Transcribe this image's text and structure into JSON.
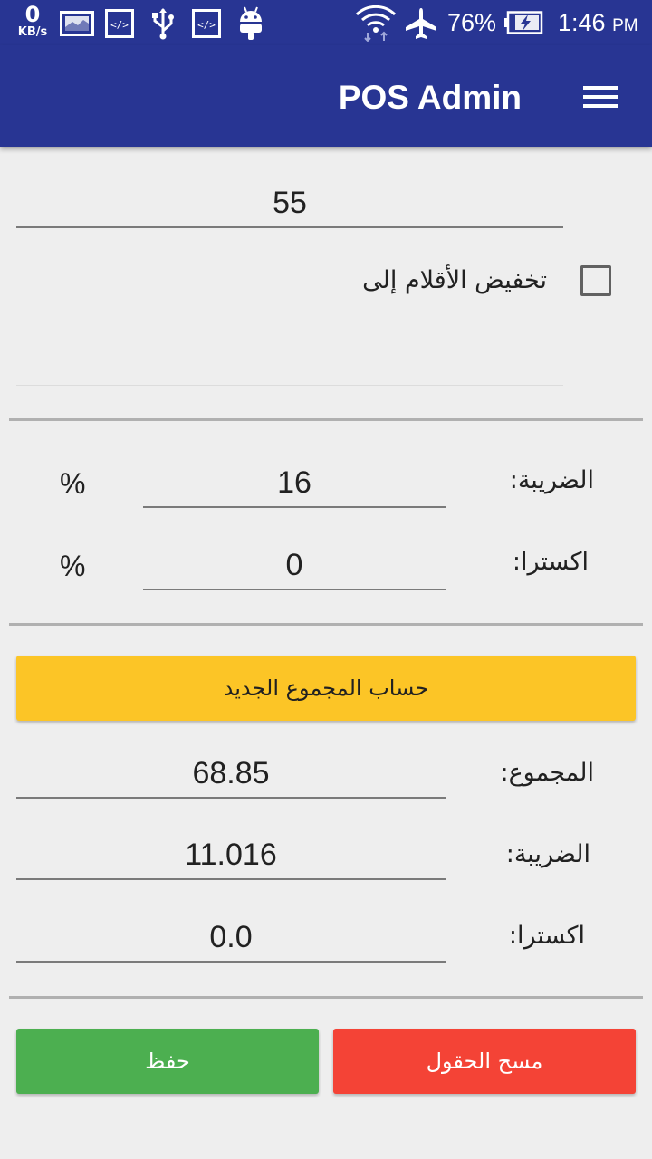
{
  "status_bar": {
    "speed_value": "0",
    "speed_unit": "KB/s",
    "battery": "76%",
    "time": "1:46",
    "ampm": "PM"
  },
  "app_bar": {
    "title": "POS Admin"
  },
  "discount": {
    "value": "55",
    "checkbox_label": "تخفيض الأقلام إلى",
    "checked": false
  },
  "rates": {
    "tax_label": "الضريبة:",
    "tax_value": "16",
    "extra_label": "اكسترا:",
    "extra_value": "0",
    "percent": "%"
  },
  "calc_button": "حساب المجموع الجديد",
  "totals": {
    "total_label": "المجموع:",
    "total_value": "68.85",
    "tax_label": "الضريبة:",
    "tax_value": "11.016",
    "extra_label": "اكسترا:",
    "extra_value": "0.0"
  },
  "actions": {
    "save": "حفظ",
    "clear": "مسح الحقول"
  },
  "colors": {
    "primary": "#283593",
    "accent": "#fcc526",
    "save": "#4caf50",
    "clear": "#f44336"
  }
}
